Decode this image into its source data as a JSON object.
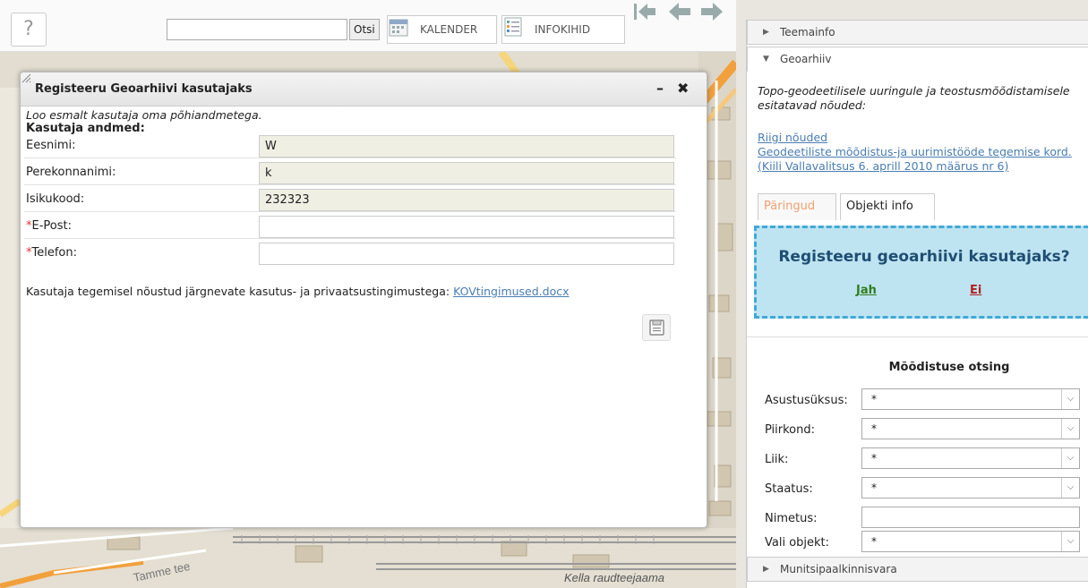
{
  "toolbar": {
    "help_label": "?",
    "search_value": "",
    "search_button": "Otsi",
    "kalender_label": "KALENDER",
    "infokihid_label": "INFOKIHID"
  },
  "map": {
    "road_label_1": "Tamme tee",
    "road_label_2": "Kella raudteejaama"
  },
  "dialog": {
    "title": "Registeeru Geoarhiivi kasutajaks",
    "minimize": "–",
    "close": "✖",
    "intro": "Loo esmalt kasutaja oma põhiandmetega.",
    "section": "Kasutaja andmed:",
    "fields": [
      {
        "label": "Eesnimi:",
        "value": "W",
        "required": false
      },
      {
        "label": "Perekonnanimi:",
        "value": "k",
        "required": false
      },
      {
        "label": "Isikukood:",
        "value": "232323",
        "required": false
      },
      {
        "label": "E-Post:",
        "value": "",
        "required": true
      },
      {
        "label": "Telefon:",
        "value": "",
        "required": true
      }
    ],
    "required_mark": "*",
    "consent_text": "Kasutaja tegemisel nõustud järgnevate kasutus- ja privaatsustingimustega:",
    "consent_link": "KOVtingimused.docx"
  },
  "panel": {
    "teemainfo": "Teemainfo",
    "geoarhiiv": "Geoarhiiv",
    "description": "Topo-geodeetilisele uuringule ja teostusmõõdistamisele esitatavad nõuded:",
    "link_riigi": "Riigi nõuded",
    "link_kord": "Geodeetiliste mõõdistus-ja uurimistööde tegemise kord. (Kiili Vallavalitsus 6. aprill 2010 määrus nr 6)",
    "tabs": [
      "Päringud",
      "Objekti info"
    ],
    "register_question": "Registeeru geoarhiivi kasutajaks?",
    "yes": "Jah",
    "no": "Ei",
    "search_title": "Mõõdistuse otsing",
    "search_fields": [
      {
        "label": "Asustusüksus:",
        "value": "*"
      },
      {
        "label": "Piirkond:",
        "value": "*"
      },
      {
        "label": "Liik:",
        "value": "*"
      },
      {
        "label": "Staatus:",
        "value": "*"
      },
      {
        "label": "Nimetus:",
        "value": ""
      },
      {
        "label": "Vali objekt:",
        "value": "*"
      }
    ],
    "munitsipaal": "Munitsipaalkinnisvara"
  },
  "colors": {
    "dialog_header": "#e8e8e8",
    "register_box_bg": "#bee4f1",
    "register_box_border": "#41a9d8",
    "yes_color": "#2f7d1d",
    "no_color": "#b22222",
    "link_color": "#4a7db0",
    "required_color": "#d33333"
  }
}
